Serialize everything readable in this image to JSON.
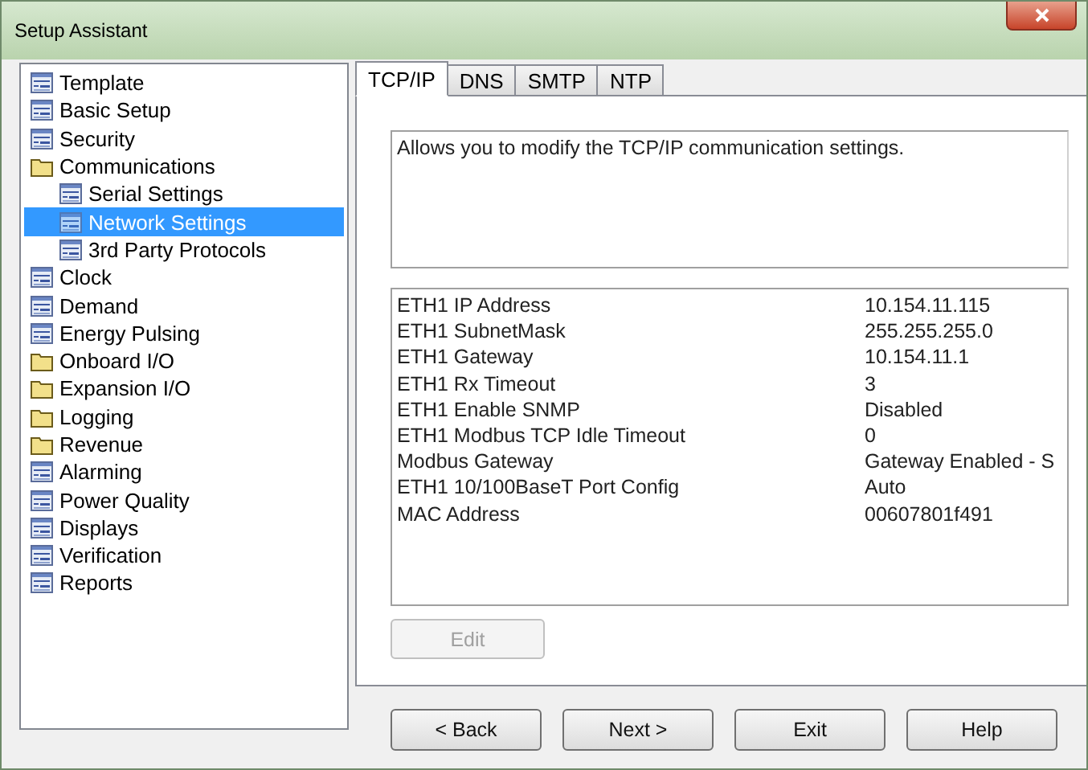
{
  "window": {
    "title": "Setup Assistant"
  },
  "tree": [
    {
      "label": "Template",
      "kind": "page",
      "selected": false
    },
    {
      "label": "Basic Setup",
      "kind": "page",
      "selected": false
    },
    {
      "label": "Security",
      "kind": "page",
      "selected": false
    },
    {
      "label": "Communications",
      "kind": "folder",
      "selected": false,
      "children": [
        {
          "label": "Serial Settings",
          "kind": "page",
          "selected": false
        },
        {
          "label": "Network Settings",
          "kind": "page",
          "selected": true
        },
        {
          "label": "3rd Party Protocols",
          "kind": "page",
          "selected": false
        }
      ]
    },
    {
      "label": "Clock",
      "kind": "page",
      "selected": false
    },
    {
      "label": "Demand",
      "kind": "page",
      "selected": false
    },
    {
      "label": "Energy Pulsing",
      "kind": "page",
      "selected": false
    },
    {
      "label": "Onboard I/O",
      "kind": "folder",
      "selected": false
    },
    {
      "label": "Expansion I/O",
      "kind": "folder",
      "selected": false
    },
    {
      "label": "Logging",
      "kind": "folder",
      "selected": false
    },
    {
      "label": "Revenue",
      "kind": "folder",
      "selected": false
    },
    {
      "label": "Alarming",
      "kind": "page",
      "selected": false
    },
    {
      "label": "Power Quality",
      "kind": "page",
      "selected": false
    },
    {
      "label": "Displays",
      "kind": "page",
      "selected": false
    },
    {
      "label": "Verification",
      "kind": "page",
      "selected": false
    },
    {
      "label": "Reports",
      "kind": "page",
      "selected": false
    }
  ],
  "tabs": [
    {
      "label": "TCP/IP",
      "selected": true
    },
    {
      "label": "DNS",
      "selected": false
    },
    {
      "label": "SMTP",
      "selected": false
    },
    {
      "label": "NTP",
      "selected": false
    }
  ],
  "description": "Allows you to modify the TCP/IP communication settings.",
  "properties": [
    {
      "name": "ETH1 IP Address",
      "value": "10.154.11.115"
    },
    {
      "name": "ETH1 SubnetMask",
      "value": "255.255.255.0"
    },
    {
      "name": "ETH1 Gateway",
      "value": "10.154.11.1"
    },
    {
      "name": "ETH1 Rx Timeout",
      "value": "3"
    },
    {
      "name": "ETH1 Enable SNMP",
      "value": "Disabled"
    },
    {
      "name": "ETH1 Modbus TCP Idle Timeout",
      "value": "0"
    },
    {
      "name": "Modbus Gateway",
      "value": "Gateway Enabled - S"
    },
    {
      "name": "ETH1 10/100BaseT Port Config",
      "value": "Auto"
    },
    {
      "name": "MAC Address",
      "value": "00607801f491"
    }
  ],
  "edit_button": {
    "label": "Edit",
    "disabled": true
  },
  "buttons": [
    {
      "label": "< Back"
    },
    {
      "label": "Next >"
    },
    {
      "label": "Exit"
    },
    {
      "label": "Help"
    }
  ]
}
